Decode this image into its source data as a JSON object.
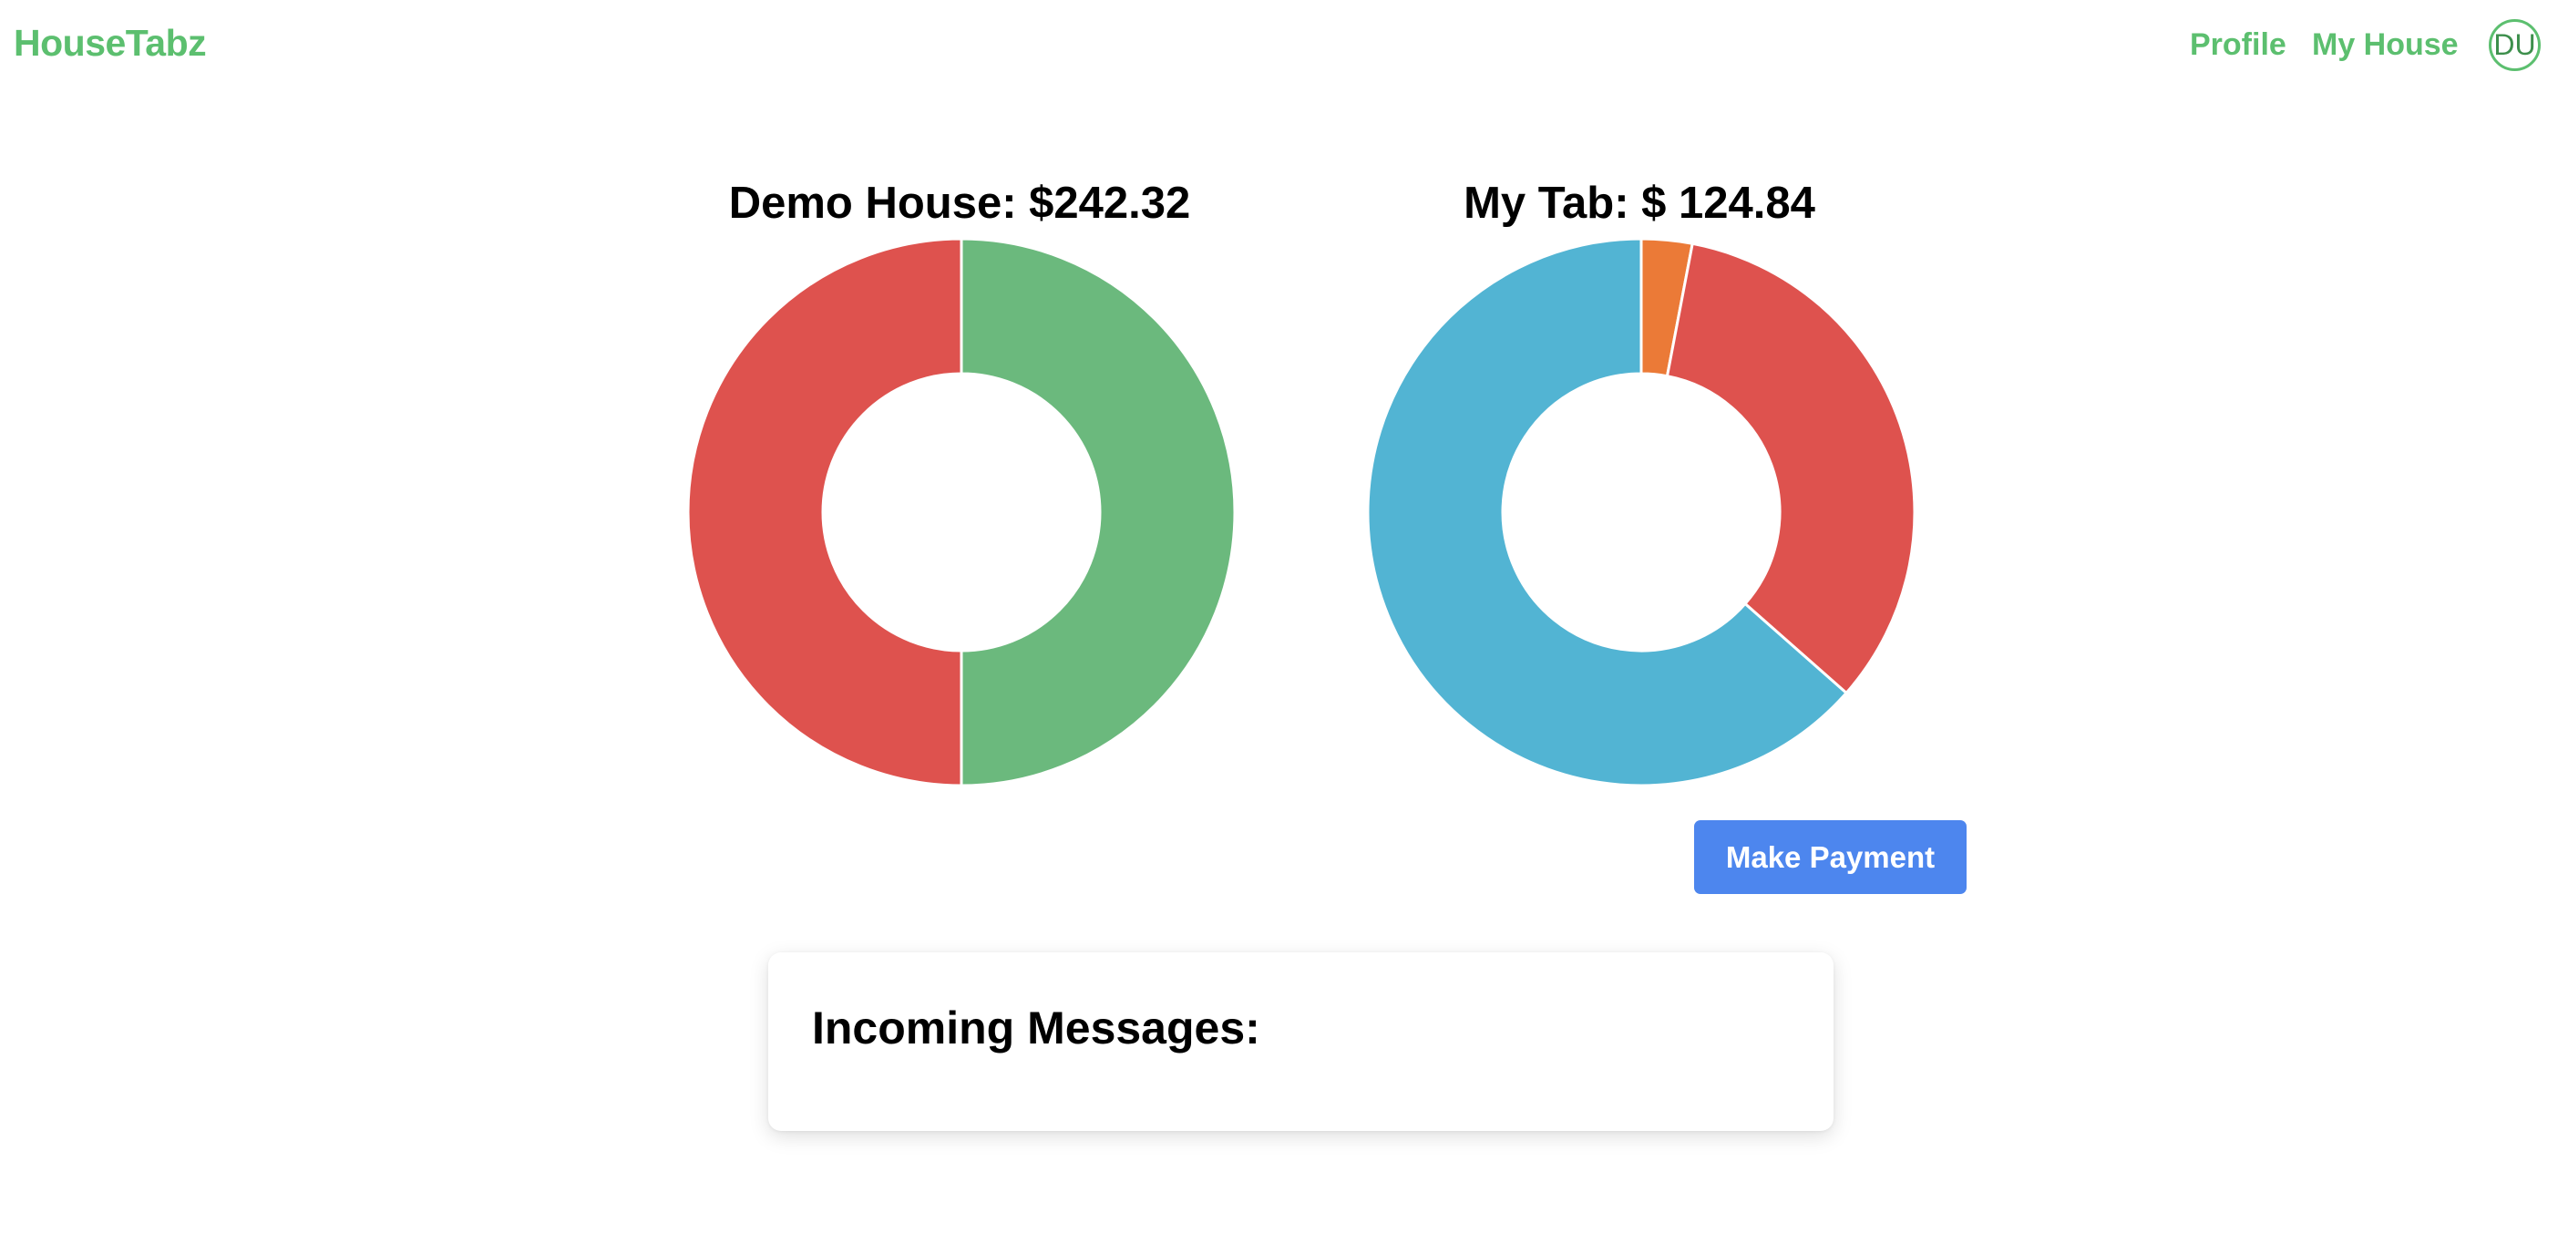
{
  "navbar": {
    "brand": "HouseTabz",
    "links": {
      "profile": "Profile",
      "my_house": "My House"
    },
    "avatar_initials": "DU",
    "accent_color": "#5cbf6f"
  },
  "chart_data": [
    {
      "type": "pie",
      "title": "Demo House: $242.32",
      "donut": true,
      "slices": [
        {
          "label": "",
          "value": 50,
          "color": "#6bb97d"
        },
        {
          "label": "",
          "value": 50,
          "color": "#de524e"
        }
      ]
    },
    {
      "type": "pie",
      "title": "My Tab: $ 124.84",
      "donut": true,
      "slices": [
        {
          "label": "",
          "value": 3,
          "color": "#eb7a37"
        },
        {
          "label": "",
          "value": 33.5,
          "color": "#de524e"
        },
        {
          "label": "",
          "value": 63.5,
          "color": "#52b4d3"
        }
      ]
    }
  ],
  "actions": {
    "make_payment": "Make Payment",
    "button_color": "#4d86ee"
  },
  "messages": {
    "title": "Incoming Messages:"
  }
}
